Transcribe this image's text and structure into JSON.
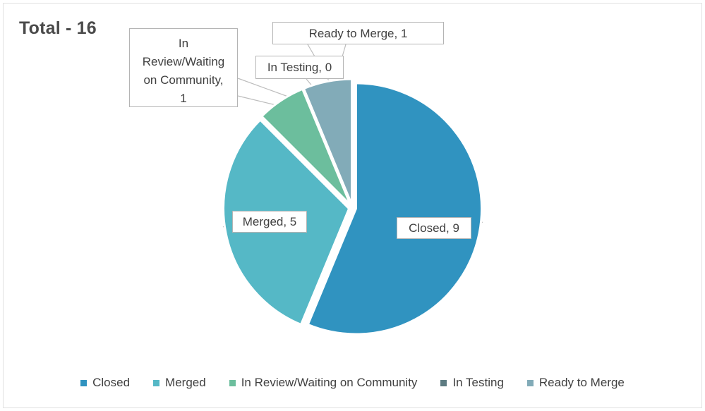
{
  "title": "Total - 16",
  "chart_data": {
    "type": "pie",
    "title": "Total - 16",
    "total": 16,
    "categories": [
      "Closed",
      "Merged",
      "In Review/Waiting on Community",
      "In Testing",
      "Ready to Merge"
    ],
    "values": [
      9,
      5,
      1,
      0,
      1
    ],
    "colors": [
      "#3093c0",
      "#55b8c6",
      "#6cbe9d",
      "#5d7b82",
      "#82abb8"
    ],
    "data_labels": [
      "Closed, 9",
      "Merged, 5",
      "In Review/Waiting\non Community,\n1",
      "In Testing, 0",
      "Ready to Merge, 1"
    ],
    "legend_position": "bottom",
    "start_angle": 0,
    "exploded": true
  },
  "labels": {
    "closed": "Closed, 9",
    "merged": "Merged, 5",
    "review": "In\nReview/Waiting\non Community,\n1",
    "testing": "In Testing, 0",
    "ready": "Ready to Merge, 1"
  },
  "legend": {
    "items": [
      {
        "label": "Closed",
        "color": "#3093c0"
      },
      {
        "label": "Merged",
        "color": "#55b8c6"
      },
      {
        "label": "In Review/Waiting on Community",
        "color": "#6cbe9d"
      },
      {
        "label": "In Testing",
        "color": "#5d7b82"
      },
      {
        "label": "Ready to Merge",
        "color": "#82abb8"
      }
    ]
  }
}
